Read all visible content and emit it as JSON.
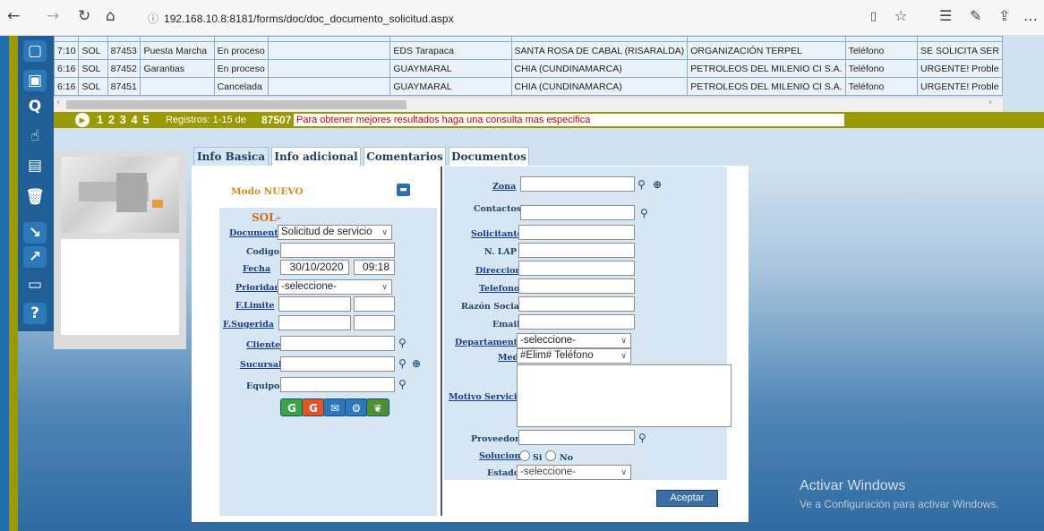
{
  "browser": {
    "url": "192.168.10.8:8181/forms/doc/doc_documento_solicitud.aspx"
  },
  "grid": {
    "rows": [
      [
        "7:10",
        "SOL",
        "87453",
        "Puesta Marcha",
        "En proceso",
        "",
        "EDS Tarapaca",
        "SANTA ROSA DE CABAL (RISARALDA)",
        "ORGANIZACIÓN TERPEL",
        "Teléfono",
        "SE SOLICITA SER"
      ],
      [
        "6:16",
        "SOL",
        "87452",
        "Garantias",
        "En proceso",
        "",
        "GUAYMARAL",
        "CHIA (CUNDINAMARCA)",
        "PETROLEOS DEL MILENIO CI S.A.",
        "Teléfono",
        "URGENTE! Proble"
      ],
      [
        "6:16",
        "SOL",
        "87451",
        "",
        "Cancelada",
        "",
        "GUAYMARAL",
        "CHIA (CUNDINAMARCA)",
        "PETROLEOS DEL MILENIO CI S.A.",
        "Teléfono",
        "URGENTE! Proble"
      ]
    ]
  },
  "pager": {
    "pages": "1 2 3 4 5",
    "registros": "Registros: 1-15 de",
    "total": "87507",
    "hint": "Para obtener mejores resultados haga una consulta mas especifica"
  },
  "tabs": [
    "Info Basica",
    "Info adicional",
    "Comentarios",
    "Documentos"
  ],
  "left": {
    "modo": "Modo NUEVO",
    "sol": "SOL-",
    "documento_label": "Documento",
    "documento_value": "Solicitud de servicio",
    "codigo_label": "Codigo",
    "fecha_label": "Fecha",
    "fecha_value": "30/10/2020",
    "hora_value": "09:18",
    "prioridad_label": "Prioridad",
    "prioridad_value": "-seleccione-",
    "flimite_label": "F.Limite",
    "fsugerida_label": "F.Sugerida",
    "cliente_label": "Cliente",
    "sucursal_label": "Sucursal",
    "equipo_label": "Equipo"
  },
  "right": {
    "zona_label": "Zona",
    "contactos_label": "Contactos",
    "solicitante_label": "Solicitante",
    "nlap_label": "N. LAP",
    "direccion_label": "Direccion",
    "telefono_label": "Telefono",
    "razon_label": "Razón Social",
    "email_label": "Email",
    "departamento_label": "Departamento",
    "departamento_value": "-seleccione-",
    "medio_label": "Medio",
    "medio_value": "#Elim# Teléfono",
    "motivo_label": "Motivo Servicio",
    "proveedor_label": "Proveedor",
    "solucion_label": "Solucion",
    "si_label": "Si",
    "no_label": "No",
    "estado_label": "Estado",
    "estado_value": "-seleccione-",
    "aceptar_label": "Aceptar"
  },
  "watermark": {
    "line1": "Activar Windows",
    "line2": "Ve a Configuración para activar Windows."
  },
  "colors": {
    "olive": "#9a9a00",
    "accent": "#1f5f95",
    "label": "#24436a"
  }
}
